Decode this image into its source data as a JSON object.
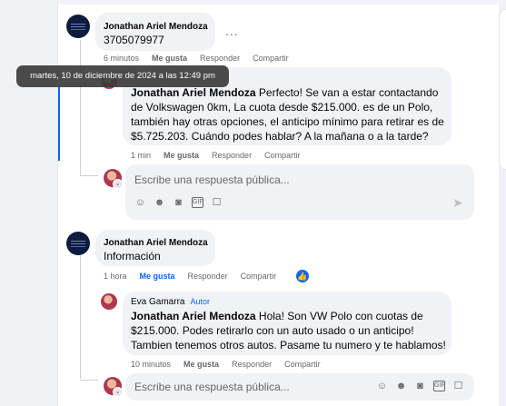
{
  "tooltip": "martes, 10 de diciembre de 2024 a las 12:49 pm",
  "comments": [
    {
      "author": "Jonathan Ariel Mendoza",
      "text": "3705079977",
      "time": "6 minutos",
      "actions": [
        "Me gusta",
        "Responder",
        "Compartir"
      ],
      "more": "..."
    },
    {
      "mention": "Jonathan Ariel Mendoza",
      "text": " Perfecto! Se van a estar contactando de Volkswagen 0km, La cuota desde $215.000. es de un Polo, también hay otras opciones, el anticipo mínimo para retirar es de $5.725.203. Cuándo podes hablar? A la mañana o a la tarde?",
      "time": "1 min",
      "actions": [
        "Me gusta",
        "Responder",
        "Compartir"
      ]
    },
    {
      "author": "Jonathan Ariel Mendoza",
      "text": "Información",
      "time": "1 hora",
      "actions": [
        "Me gusta",
        "Responder",
        "Compartir"
      ]
    },
    {
      "author": "Eva Gamarra",
      "author_tag": "Autor",
      "mention": "Jonathan Ariel Mendoza",
      "text": " Hola! Son VW Polo con cuotas de $215.000. Podes retirarlo con un auto usado o un anticipo! Tambien tenemos otros autos. Pasame tu numero y te hablamos!",
      "time": "10 minutos",
      "actions": [
        "Me gusta",
        "Responder",
        "Compartir"
      ]
    }
  ],
  "reply_placeholder": "Escribe una respuesta pública...",
  "reply_icons": [
    "avatar-sticker-icon",
    "emoji-icon",
    "camera-icon",
    "gif-icon",
    "sticker-icon"
  ],
  "colors": {
    "accent": "#0866ff",
    "bubble": "#f0f2f5",
    "muted": "#65676b"
  }
}
